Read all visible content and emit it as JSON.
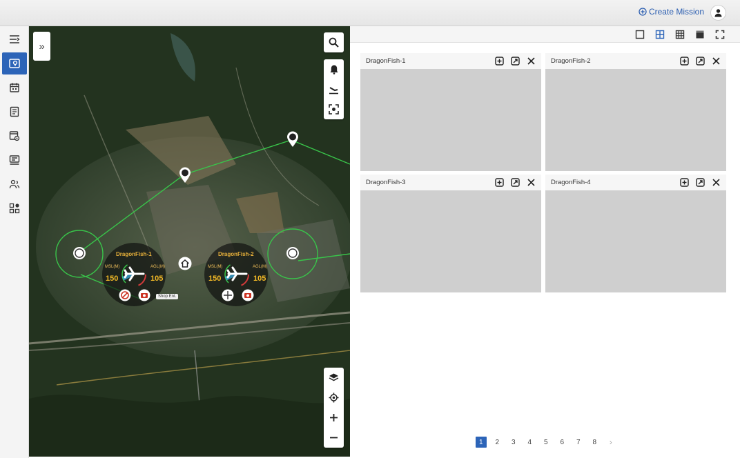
{
  "header": {
    "create_mission_label": "Create Mission",
    "accent_color": "#2a5db0"
  },
  "sidebar": {
    "items": [
      {
        "name": "menu",
        "icon": "menu-icon",
        "active": false
      },
      {
        "name": "map",
        "icon": "map-pin-icon",
        "active": true
      },
      {
        "name": "calendar",
        "icon": "calendar-icon",
        "active": false
      },
      {
        "name": "document",
        "icon": "document-icon",
        "active": false
      },
      {
        "name": "media",
        "icon": "media-settings-icon",
        "active": false
      },
      {
        "name": "device",
        "icon": "device-icon",
        "active": false
      },
      {
        "name": "users",
        "icon": "users-icon",
        "active": false
      },
      {
        "name": "apps",
        "icon": "apps-icon",
        "active": false
      }
    ]
  },
  "map": {
    "drones": [
      {
        "label": "DragonFish-1",
        "left_label": "MSL(M)",
        "right_label": "AGL(M)",
        "left_value": "150",
        "right_value": "105"
      },
      {
        "label": "DragonFish-2",
        "left_label": "MSL(M)",
        "right_label": "AGL(M)",
        "left_value": "150",
        "right_value": "105"
      }
    ],
    "shop_tooltip": "Shop Ent.",
    "waypoints": [
      "1",
      "2",
      "3"
    ]
  },
  "layout_options": [
    "single",
    "quad",
    "nine",
    "full-panel",
    "fullscreen"
  ],
  "selected_layout": "quad",
  "tiles": [
    {
      "title": "DragonFish-1"
    },
    {
      "title": "DragonFish-2"
    },
    {
      "title": "DragonFish-3"
    },
    {
      "title": "DragonFish-4"
    }
  ],
  "pagination": {
    "pages": [
      "1",
      "2",
      "3",
      "4",
      "5",
      "6",
      "7",
      "8"
    ],
    "current": "1",
    "next": "›"
  }
}
